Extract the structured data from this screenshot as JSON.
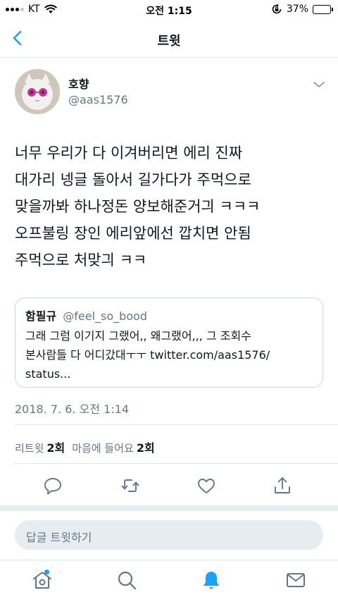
{
  "status_bar": {
    "carrier": "KT",
    "time": "오전 1:15",
    "battery_percent": "37%",
    "battery_level": 0.37
  },
  "nav": {
    "title": "트윗",
    "back_icon": "chevron-left-icon"
  },
  "author": {
    "name": "호향",
    "handle": "@aas1576"
  },
  "tweet": {
    "lines": [
      "너무 우리가 다 이겨버리면 에리 진짜",
      "대가리 넹글 돌아서 길가다가 주먹으로",
      "맞을까봐 하나정돈 양보해준거긔 ㅋㅋㅋ",
      "오프불링 장인 에리앞에선 깝치면 안됨",
      "주먹으로 처맞긔 ㅋㅋ"
    ],
    "timestamp": "2018. 7. 6. 오전 1:14"
  },
  "quote": {
    "name": "함필규",
    "handle": "@feel_so_bood",
    "lines": [
      "그래 그럼 이기지 그랬어,, 왜그랬어,,, 그 조회수",
      "본사람들 다 어디갔대ㅜㅜ twitter.com/aas1576/",
      "status..."
    ]
  },
  "stats": {
    "retweet_label": "리트윗",
    "retweet_count": "2회",
    "like_label": "마음에 들어요",
    "like_count": "2회"
  },
  "actions": [
    "reply-icon",
    "retweet-icon",
    "heart-icon",
    "share-icon"
  ],
  "reply": {
    "placeholder": "답글 트윗하기"
  },
  "tab_bar": {
    "tabs": [
      "home-icon",
      "search-icon",
      "notifications-icon",
      "messages-icon"
    ],
    "active": "notifications-icon"
  },
  "colors": {
    "accent": "#1da1f2",
    "secondary_text": "#657786",
    "divider": "#e1e8ed"
  }
}
